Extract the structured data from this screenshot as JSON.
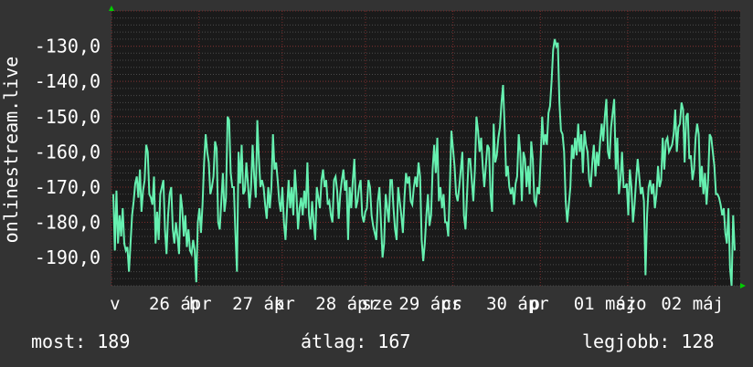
{
  "footer": {
    "now_label": "most:",
    "now_value": "189",
    "avg_label": "átlag:",
    "avg_value": "167",
    "best_label": "legjobb:",
    "best_value": "128"
  },
  "colors": {
    "background": "#333333",
    "plot_background": "#1a1a1a",
    "line": "#66f0b0",
    "major_grid": "#7a2a2a",
    "minor_grid": "#4a4a4a",
    "arrow": "#00cc00"
  },
  "chart_data": {
    "type": "line",
    "title": "",
    "ylabel": "onlinestream.live",
    "ylim": [
      -198,
      -120
    ],
    "yticks": [
      -130,
      -140,
      -150,
      -160,
      -170,
      -180,
      -190
    ],
    "ytick_labels": [
      "-130,0",
      "-140,0",
      "-150,0",
      "-160,0",
      "-170,0",
      "-180,0",
      "-190,0"
    ],
    "xlim": [
      0,
      7.55
    ],
    "xticks": [
      0.0,
      1.05,
      2.05,
      3.05,
      4.1,
      5.15,
      6.2,
      7.25
    ],
    "xtick_labels": [
      "v",
      "26 ápr",
      "h",
      "27 ápr",
      "k",
      "28 ápr",
      "sze",
      "29 ápr",
      "cs",
      "30 ápr",
      "p",
      "01 máj",
      "szo",
      "02 máj"
    ],
    "xtick_label_positions": [
      -0.02,
      0.45,
      0.93,
      1.45,
      1.95,
      2.45,
      3.0,
      3.45,
      3.96,
      4.5,
      5.02,
      5.55,
      6.05,
      6.6
    ],
    "grid": true,
    "grid_major_y": [
      -200,
      -190,
      -180,
      -170,
      -160,
      -150,
      -140,
      -130,
      -120
    ],
    "series": [
      {
        "name": "",
        "values": [
          -172,
          -188,
          -171,
          -186,
          -178,
          -184,
          -176,
          -186,
          -188,
          -187,
          -194,
          -186,
          -178,
          -174,
          -169,
          -167,
          -173,
          -165,
          -177,
          -171,
          -168,
          -158,
          -160,
          -172,
          -173,
          -175,
          -167,
          -186,
          -177,
          -185,
          -172,
          -170,
          -168,
          -182,
          -189,
          -178,
          -172,
          -170,
          -182,
          -186,
          -180,
          -184,
          -189,
          -172,
          -176,
          -184,
          -178,
          -187,
          -182,
          -188,
          -189,
          -185,
          -188,
          -197,
          -180,
          -176,
          -183,
          -175,
          -163,
          -155,
          -160,
          -163,
          -172,
          -170,
          -167,
          -157,
          -159,
          -180,
          -182,
          -174,
          -166,
          -177,
          -173,
          -150,
          -151,
          -166,
          -170,
          -170,
          -183,
          -194,
          -160,
          -169,
          -158,
          -172,
          -171,
          -163,
          -169,
          -176,
          -170,
          -158,
          -167,
          -173,
          -151,
          -162,
          -170,
          -168,
          -170,
          -175,
          -179,
          -170,
          -176,
          -170,
          -155,
          -165,
          -163,
          -168,
          -174,
          -177,
          -170,
          -180,
          -185,
          -176,
          -168,
          -176,
          -170,
          -178,
          -165,
          -172,
          -182,
          -176,
          -173,
          -178,
          -171,
          -176,
          -163,
          -178,
          -182,
          -174,
          -180,
          -185,
          -170,
          -173,
          -176,
          -168,
          -165,
          -170,
          -168,
          -175,
          -174,
          -178,
          -180,
          -168,
          -167,
          -171,
          -179,
          -172,
          -168,
          -165,
          -171,
          -168,
          -185,
          -170,
          -176,
          -168,
          -162,
          -176,
          -174,
          -170,
          -168,
          -178,
          -180,
          -177,
          -176,
          -168,
          -170,
          -178,
          -181,
          -183,
          -185,
          -174,
          -170,
          -180,
          -190,
          -186,
          -172,
          -176,
          -180,
          -168,
          -168,
          -176,
          -182,
          -185,
          -170,
          -174,
          -178,
          -183,
          -173,
          -166,
          -169,
          -167,
          -174,
          -175,
          -170,
          -167,
          -170,
          -163,
          -167,
          -185,
          -191,
          -186,
          -178,
          -172,
          -181,
          -178,
          -165,
          -158,
          -166,
          -156,
          -174,
          -170,
          -176,
          -172,
          -180,
          -180,
          -184,
          -170,
          -154,
          -159,
          -164,
          -172,
          -174,
          -170,
          -165,
          -160,
          -178,
          -182,
          -172,
          -162,
          -162,
          -168,
          -174,
          -165,
          -150,
          -154,
          -160,
          -156,
          -164,
          -170,
          -164,
          -158,
          -159,
          -172,
          -177,
          -152,
          -163,
          -161,
          -156,
          -153,
          -146,
          -141,
          -153,
          -167,
          -164,
          -170,
          -172,
          -170,
          -175,
          -169,
          -167,
          -155,
          -160,
          -174,
          -160,
          -162,
          -170,
          -164,
          -172,
          -157,
          -162,
          -174,
          -175,
          -170,
          -172,
          -162,
          -150,
          -158,
          -155,
          -158,
          -149,
          -147,
          -140,
          -131,
          -128,
          -130,
          -129,
          -146,
          -154,
          -155,
          -160,
          -174,
          -180,
          -175,
          -170,
          -158,
          -162,
          -156,
          -161,
          -152,
          -160,
          -155,
          -166,
          -154,
          -158,
          -160,
          -168,
          -170,
          -163,
          -158,
          -167,
          -160,
          -164,
          -157,
          -152,
          -157,
          -150,
          -145,
          -160,
          -162,
          -153,
          -149,
          -145,
          -165,
          -156,
          -172,
          -168,
          -160,
          -170,
          -170,
          -169,
          -178,
          -165,
          -170,
          -180,
          -175,
          -168,
          -162,
          -167,
          -172,
          -170,
          -174,
          -195,
          -178,
          -170,
          -168,
          -172,
          -169,
          -176,
          -172,
          -164,
          -170,
          -168,
          -156,
          -165,
          -157,
          -156,
          -160,
          -159,
          -158,
          -155,
          -148,
          -160,
          -153,
          -152,
          -146,
          -148,
          -163,
          -150,
          -149,
          -162,
          -161,
          -168,
          -165,
          -156,
          -152,
          -155,
          -170,
          -164,
          -172,
          -166,
          -175,
          -168,
          -155,
          -156,
          -160,
          -164,
          -172,
          -172,
          -173,
          -175,
          -178,
          -176,
          -183,
          -186,
          -176,
          -193,
          -198,
          -178,
          -188
        ]
      }
    ]
  }
}
